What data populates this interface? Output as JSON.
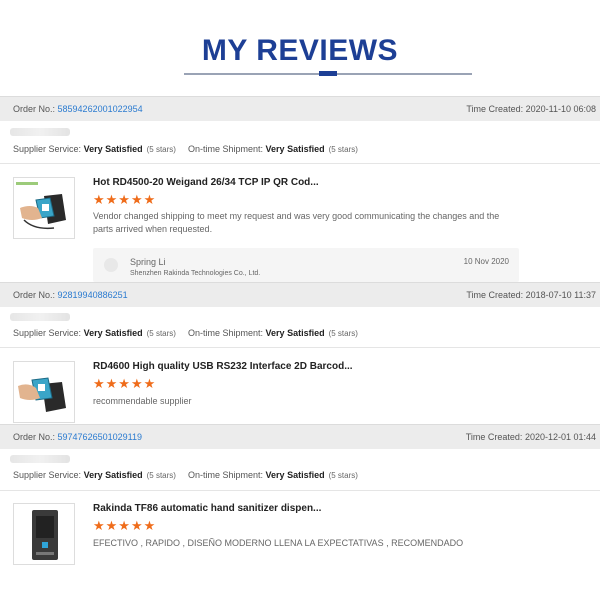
{
  "page": {
    "title": "MY REVIEWS"
  },
  "labels": {
    "order_no": "Order No.:",
    "time_created": "Time Created:",
    "supplier_service": "Supplier Service:",
    "ontime_shipment": "On-time Shipment:"
  },
  "reviews": [
    {
      "order_no": "58594262001022954",
      "time_created": "2020-11-10 06:08",
      "supplier_service": "Very Satisfied",
      "supplier_stars": "(5 stars)",
      "ontime_shipment": "Very Satisfied",
      "ontime_stars": "(5 stars)",
      "product_title": "Hot RD4500-20 Weigand 26/34 TCP IP QR Cod...",
      "rating": 5,
      "stars_text": "★★★★★",
      "comment": "Vendor changed shipping to meet my request and was very good communicating the changes and the parts arrived when requested.",
      "reply": {
        "name": "Spring Li",
        "company": "Shenzhen Rakinda Technologies Co., Ltd.",
        "date": "10 Nov 2020"
      }
    },
    {
      "order_no": "92819940886251",
      "time_created": "2018-07-10 11:37",
      "supplier_service": "Very Satisfied",
      "supplier_stars": "(5 stars)",
      "ontime_shipment": "Very Satisfied",
      "ontime_stars": "(5 stars)",
      "product_title": "RD4600 High quality USB RS232 Interface 2D Barcod...",
      "rating": 5,
      "stars_text": "★★★★★",
      "comment": "recommendable supplier"
    },
    {
      "order_no": "59747626501029119",
      "time_created": "2020-12-01 01:44",
      "supplier_service": "Very Satisfied",
      "supplier_stars": "(5 stars)",
      "ontime_shipment": "Very Satisfied",
      "ontime_stars": "(5 stars)",
      "product_title": "Rakinda TF86 automatic hand sanitizer dispen...",
      "rating": 5,
      "stars_text": "★★★★★",
      "comment": "EFECTIVO , RAPIDO , DISEÑO MODERNO LLENA LA EXPECTATIVAS , RECOMENDADO"
    }
  ],
  "colors": {
    "title": "#1d3f95",
    "link": "#2b7bd0",
    "star": "#ef6c1a",
    "bar": "#ececec"
  }
}
